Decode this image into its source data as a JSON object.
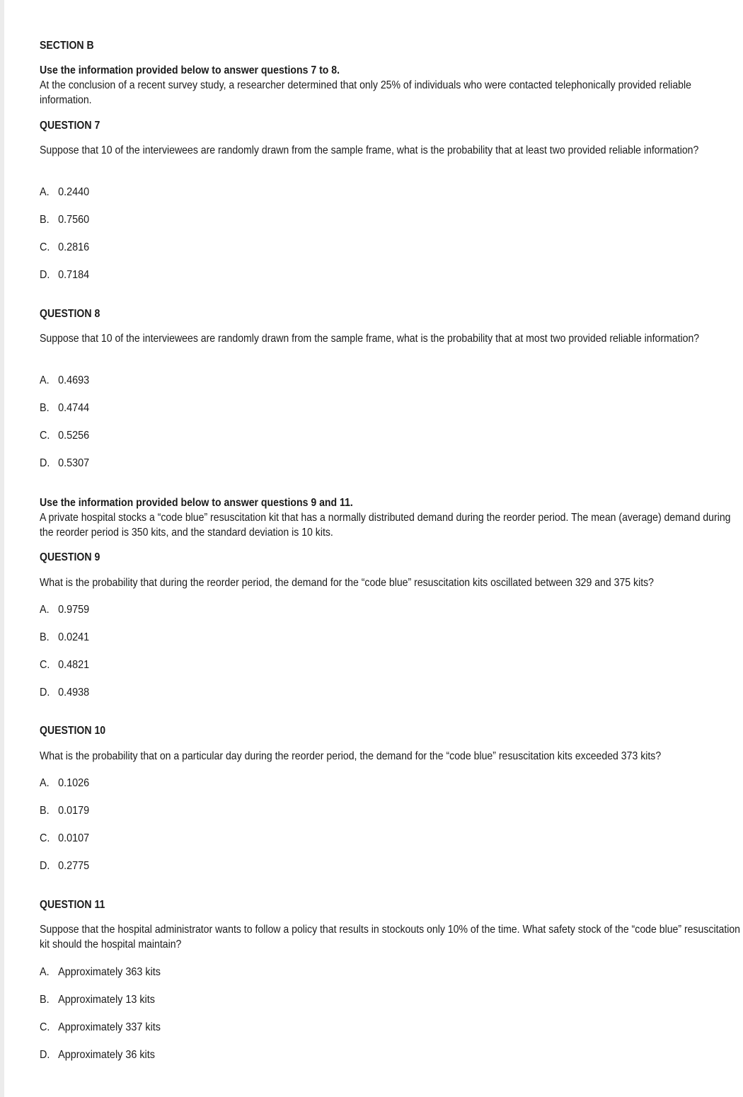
{
  "section_title": "SECTION B",
  "groups": [
    {
      "intro_heading": "Use the information provided below to answer questions 7 to 8.",
      "intro_text": "At the conclusion of a recent survey study, a researcher determined that only 25% of individuals who were contacted telephonically provided reliable information."
    },
    {
      "intro_heading": "Use the information provided below to answer questions 9 and 11.",
      "intro_text": "A private hospital stocks a “code blue” resuscitation kit that has a normally distributed demand during the reorder period. The mean (average) demand during the reorder period is 350 kits, and the standard deviation is 10 kits."
    }
  ],
  "questions": [
    {
      "title": "QUESTION  7",
      "text": "Suppose that 10 of the interviewees are randomly drawn from the sample frame, what is the probability that at least two provided reliable information?",
      "options": [
        {
          "letter": "A.",
          "text": "0.2440"
        },
        {
          "letter": "B.",
          "text": "0.7560"
        },
        {
          "letter": "C.",
          "text": "0.2816"
        },
        {
          "letter": "D.",
          "text": "0.7184"
        }
      ]
    },
    {
      "title": "QUESTION  8",
      "text": "Suppose that 10 of the interviewees are randomly drawn from the sample frame, what is the probability that at most two provided reliable information?",
      "options": [
        {
          "letter": "A.",
          "text": "0.4693"
        },
        {
          "letter": "B.",
          "text": "0.4744"
        },
        {
          "letter": "C.",
          "text": "0.5256"
        },
        {
          "letter": "D.",
          "text": "0.5307"
        }
      ]
    },
    {
      "title": "QUESTION  9",
      "text": "What is the probability that during the reorder period, the demand for the “code blue” resuscitation kits oscillated between 329 and 375 kits?",
      "options": [
        {
          "letter": "A.",
          "text": "0.9759"
        },
        {
          "letter": "B.",
          "text": "0.0241"
        },
        {
          "letter": "C.",
          "text": "0.4821"
        },
        {
          "letter": "D.",
          "text": "0.4938"
        }
      ]
    },
    {
      "title": "QUESTION  10",
      "text": "What is the probability that on a particular day during the reorder period, the demand for the “code blue” resuscitation kits exceeded 373 kits?",
      "options": [
        {
          "letter": "A.",
          "text": "0.1026"
        },
        {
          "letter": "B.",
          "text": "0.0179"
        },
        {
          "letter": "C.",
          "text": "0.0107"
        },
        {
          "letter": "D.",
          "text": "0.2775"
        }
      ]
    },
    {
      "title": "QUESTION  11",
      "text": "Suppose that the hospital administrator wants to follow a policy that results in stockouts only 10% of the time. What safety stock of the “code blue” resuscitation kit should the hospital maintain?",
      "options": [
        {
          "letter": "A.",
          "text": "Approximately 363 kits"
        },
        {
          "letter": "B.",
          "text": "Approximately 13 kits"
        },
        {
          "letter": "C.",
          "text": "Approximately 337 kits"
        },
        {
          "letter": "D.",
          "text": "Approximately 36 kits"
        }
      ]
    }
  ]
}
